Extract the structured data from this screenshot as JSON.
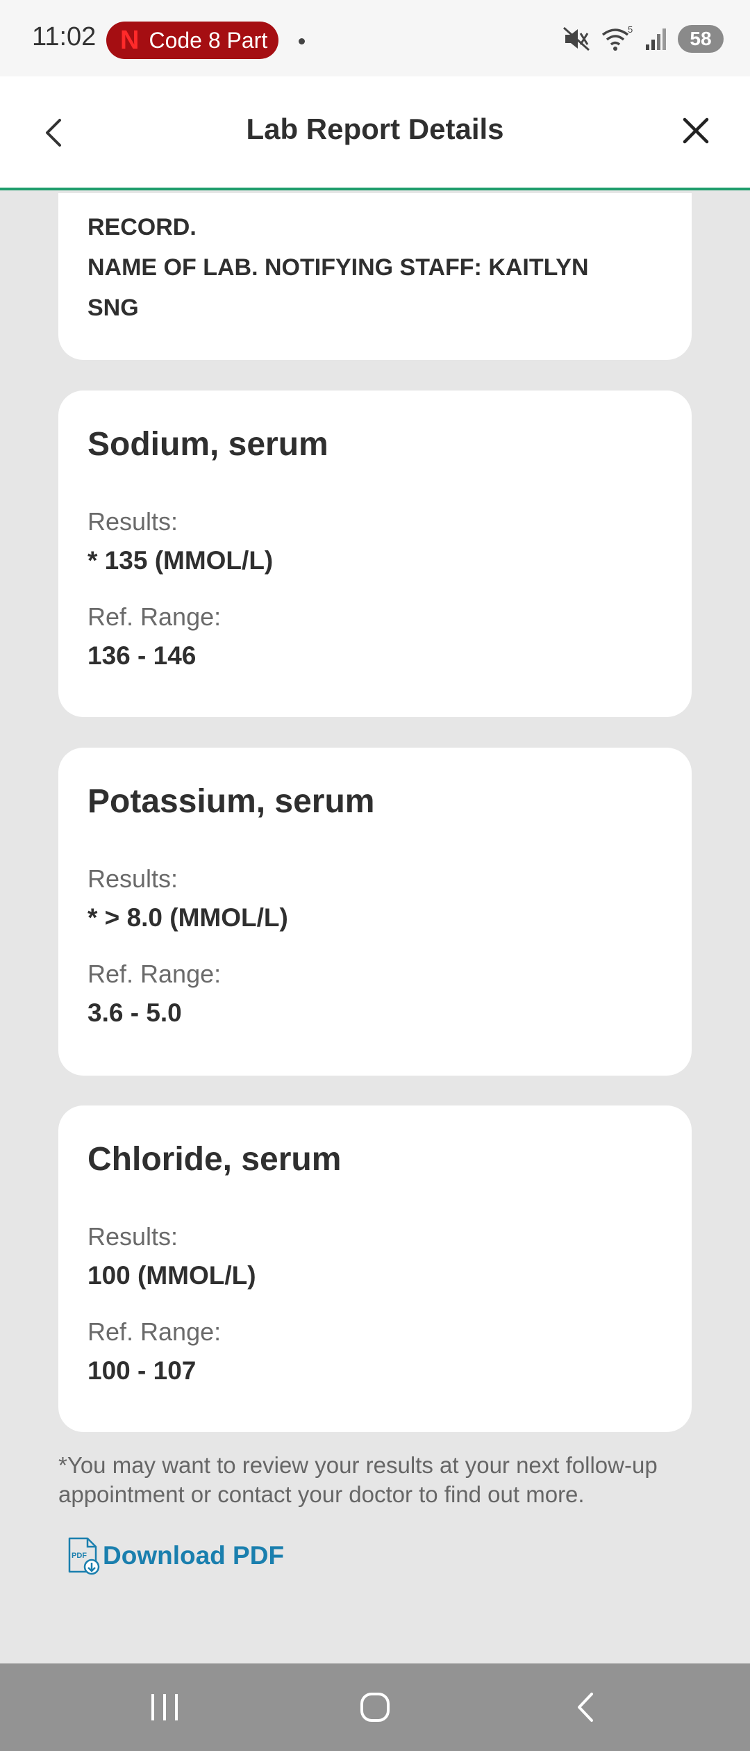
{
  "status_bar": {
    "time": "11:02",
    "notification_app_label": "Code 8 Part",
    "netflix_mark": "N",
    "wifi_badge": "5",
    "battery": "58"
  },
  "header": {
    "title": "Lab Report Details"
  },
  "note_card": {
    "lines": [
      "RECORD.",
      "NAME OF LAB. NOTIFYING STAFF: KAITLYN",
      "SNG"
    ]
  },
  "tests": [
    {
      "name": "Sodium, serum",
      "results_label": "Results:",
      "results_value": "* 135 (MMOL/L)",
      "range_label": "Ref. Range:",
      "range_value": "136 - 146"
    },
    {
      "name": "Potassium, serum",
      "results_label": "Results:",
      "results_value": "* > 8.0 (MMOL/L)",
      "range_label": "Ref. Range:",
      "range_value": "3.6 - 5.0"
    },
    {
      "name": "Chloride, serum",
      "results_label": "Results:",
      "results_value": "100 (MMOL/L)",
      "range_label": "Ref. Range:",
      "range_value": "100 - 107"
    }
  ],
  "footer": {
    "disclaimer": "*You may want to review your results at your next follow-up appointment or contact your doctor to find out more.",
    "download_label": "Download PDF",
    "pdf_icon_text": "PDF"
  },
  "colors": {
    "accent_green": "#1f9d6c",
    "link_blue": "#1a7fae",
    "netflix_red": "#a50e12"
  },
  "icons": {
    "back": "chevron-left-icon",
    "close": "close-icon",
    "pdf": "pdf-download-icon",
    "mute": "mute-icon",
    "wifi": "wifi-icon",
    "signal": "signal-icon"
  }
}
